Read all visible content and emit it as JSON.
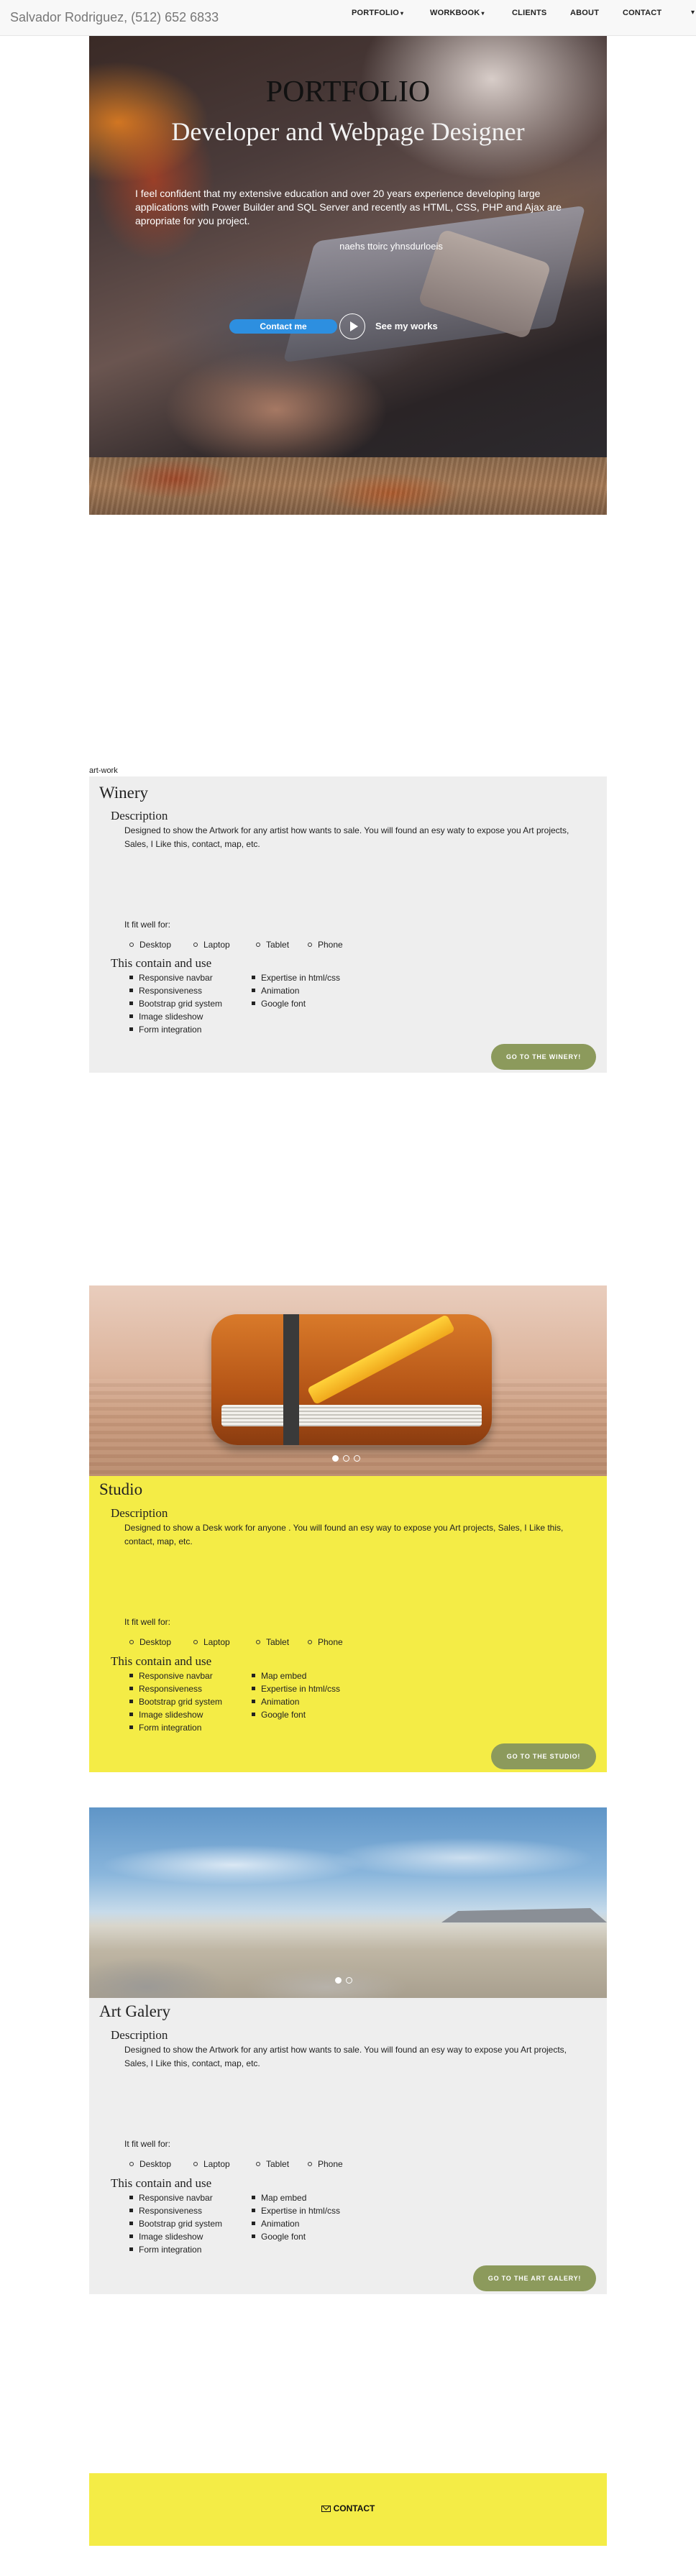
{
  "navbar": {
    "brand": "Salvador Rodriguez, (512) 652 6833",
    "items": [
      {
        "label": "PORTFOLIO",
        "dropdown": true
      },
      {
        "label": "WORKBOOK",
        "dropdown": true
      },
      {
        "label": "CLIENTS",
        "dropdown": false
      },
      {
        "label": "ABOUT",
        "dropdown": false
      },
      {
        "label": "CONTACT",
        "dropdown": false
      }
    ],
    "caret": "▾",
    "overflow_glyph": "▾"
  },
  "hero": {
    "title": "PORTFOLIO",
    "subtitle": "Developer and Webpage Designer",
    "text": "I feel confident that my extensive education and over 20 years experience developing large applications with Power Builder and SQL Server and recently as HTML, CSS, PHP and Ajax are apropriate for you project.",
    "signature": "naehs ttoirc yhnsdurloeis",
    "contact_button": "Contact me",
    "see_works": "See my works"
  },
  "section_label": "art-work",
  "projects": [
    {
      "title": "Winery",
      "description_heading": "Description",
      "description": "Designed to show the Artwork for any artist how wants to sale. You will found an esy waty to expose you Art projects, Sales, I Like this, contact, map, etc.",
      "fit_label": "It fit well for:",
      "devices": [
        "Desktop",
        "Laptop",
        "Tablet",
        "Phone"
      ],
      "contains_heading": "This contain and use",
      "features_left": [
        "Responsive navbar",
        "Responsiveness",
        "Bootstrap grid system",
        "Image slideshow",
        "Form integration"
      ],
      "features_right": [
        "Expertise in html/css",
        "Animation",
        "Google font"
      ],
      "button": "GO TO THE WINERY!"
    },
    {
      "title": "Studio",
      "description_heading": "Description",
      "description": "Designed to show a Desk work for anyone . You will found an esy way to expose you Art projects, Sales, I Like this, contact, map, etc.",
      "fit_label": "It fit well for:",
      "devices": [
        "Desktop",
        "Laptop",
        "Tablet",
        "Phone"
      ],
      "contains_heading": "This contain and use",
      "features_left": [
        "Responsive navbar",
        "Responsiveness",
        "Bootstrap grid system",
        "Image slideshow",
        "Form integration"
      ],
      "features_right": [
        "Map embed",
        "Expertise in html/css",
        "Animation",
        "Google font"
      ],
      "button": "GO TO THE STUDIO!"
    },
    {
      "title": "Art Galery",
      "description_heading": "Description",
      "description": "Designed to show the Artwork for any artist how wants to sale. You will found an esy way to expose you Art projects, Sales, I Like this, contact, map, etc.",
      "fit_label": "It fit well for:",
      "devices": [
        "Desktop",
        "Laptop",
        "Tablet",
        "Phone"
      ],
      "contains_heading": "This contain and use",
      "features_left": [
        "Responsive navbar",
        "Responsiveness",
        "Bootstrap grid system",
        "Image slideshow",
        "Form integration"
      ],
      "features_right": [
        "Map embed",
        "Expertise in html/css",
        "Animation",
        "Google font"
      ],
      "button": "GO TO THE ART GALERY!"
    }
  ],
  "footer": {
    "contact": "CONTACT",
    "icon": "envelope-icon"
  },
  "colors": {
    "navbar_bg": "#f8f8f8",
    "card_gray": "#eeeeee",
    "card_yellow": "#f4ec46",
    "go_button": "#8c9a5c",
    "hero_button": "#2d8fe0"
  }
}
